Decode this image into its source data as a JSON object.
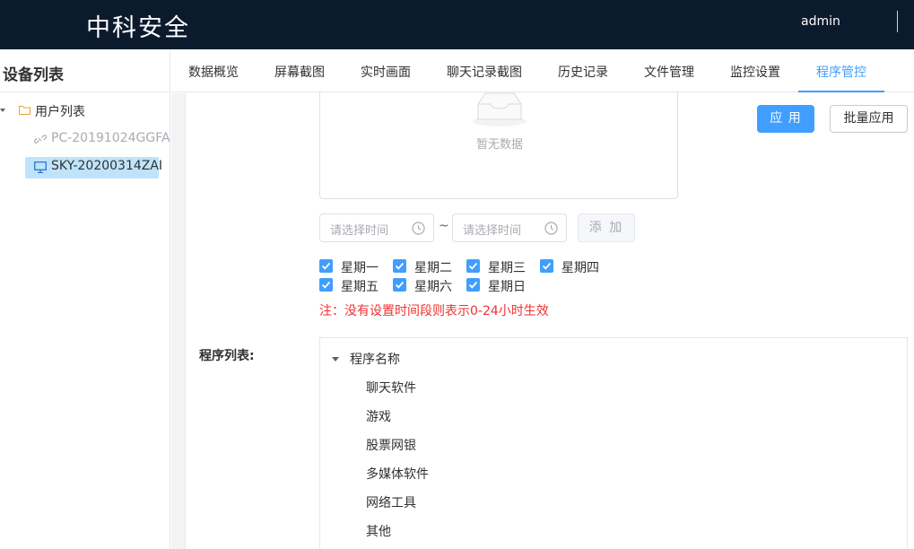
{
  "header": {
    "brand": "中科安全",
    "user": "admin"
  },
  "sidebar": {
    "title": "设备列表",
    "tree": {
      "root_label": "用户列表",
      "devices": [
        {
          "name": "PC-20191024GGFA",
          "status": "offline"
        },
        {
          "name": "SKY-20200314ZAI",
          "status": "online",
          "selected": true
        }
      ]
    }
  },
  "tabs": [
    {
      "label": "数据概览"
    },
    {
      "label": "屏幕截图"
    },
    {
      "label": "实时画面"
    },
    {
      "label": "聊天记录截图"
    },
    {
      "label": "历史记录"
    },
    {
      "label": "文件管理"
    },
    {
      "label": "监控设置"
    },
    {
      "label": "程序管控",
      "active": true
    }
  ],
  "main": {
    "empty_text": "暂无数据",
    "apply_label": "应 用",
    "batch_apply_label": "批量应用",
    "time_start_placeholder": "请选择时间",
    "time_end_placeholder": "请选择时间",
    "range_separator": "~",
    "add_label": "添 加",
    "weekdays": [
      {
        "label": "星期一",
        "checked": true
      },
      {
        "label": "星期二",
        "checked": true
      },
      {
        "label": "星期三",
        "checked": true
      },
      {
        "label": "星期四",
        "checked": true
      },
      {
        "label": "星期五",
        "checked": true
      },
      {
        "label": "星期六",
        "checked": true
      },
      {
        "label": "星期日",
        "checked": true
      }
    ],
    "note": "注：没有设置时间段则表示0-24小时生效",
    "program_list_label": "程序列表:",
    "program_tree": {
      "root": "程序名称",
      "items": [
        "聊天软件",
        "游戏",
        "股票网银",
        "多媒体软件",
        "网络工具",
        "其他"
      ]
    }
  },
  "colors": {
    "header_bg": "#0c1a2e",
    "accent": "#409eff",
    "note": "#f23030",
    "selected_bg": "#bfe3fa"
  }
}
